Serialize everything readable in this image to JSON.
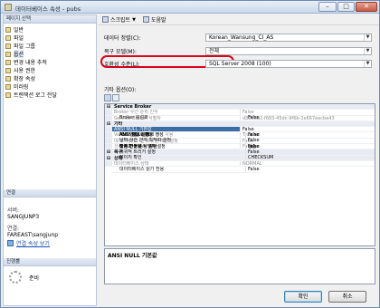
{
  "window": {
    "title": "데이터베이스 속성 - pubs"
  },
  "left": {
    "pages_header": "페이지 선택",
    "pages": [
      {
        "label": "일반",
        "selected": false
      },
      {
        "label": "파일",
        "selected": false
      },
      {
        "label": "파일 그룹",
        "selected": false
      },
      {
        "label": "옵션",
        "selected": true
      },
      {
        "label": "변경 내용 추적",
        "selected": false
      },
      {
        "label": "사용 권한",
        "selected": false
      },
      {
        "label": "확장 속성",
        "selected": false
      },
      {
        "label": "미러링",
        "selected": false
      },
      {
        "label": "트랜잭션 로그 전달",
        "selected": false
      }
    ],
    "connection_header": "연결",
    "server_label": "서버:",
    "server_value": "SANGJUNP3",
    "connection_label": "연결:",
    "connection_value": "FAREAST\\sangjunp",
    "connection_link": "연결 속성 보기",
    "progress_header": "진행률",
    "progress_status": "준비"
  },
  "toolbar": {
    "script_label": "스크립트",
    "help_label": "도움말"
  },
  "form": {
    "collation_label": "데이터 정렬(C):",
    "collation_value": "Korean_Wansung_CI_AS",
    "recovery_label": "복구 모델(M):",
    "recovery_value": "전체",
    "compat_label": "호환성 수준(L):",
    "compat_value": "SQL Server 2008 (100)",
    "other_options_label": "기타 옵션(O):"
  },
  "properties": [
    {
      "type": "cat",
      "name": "Service Broker",
      "value": ""
    },
    {
      "type": "ro",
      "name": "Broker 우선 순위 인식",
      "value": "False"
    },
    {
      "type": "row",
      "name": "Broker 활성화",
      "value": "False"
    },
    {
      "type": "ro",
      "name": "Service Broker 식별자",
      "value": "d3298b2-f683-45dc-9f6b-2e667eecbe43"
    },
    {
      "type": "cat",
      "name": "기타",
      "value": ""
    },
    {
      "type": "sel",
      "name": "ANSI NULL 기본값",
      "value": "False"
    },
    {
      "type": "row",
      "name": "ANSI NULL 설정",
      "value": "False"
    },
    {
      "type": "row",
      "name": "ANSI 경고 설정",
      "value": "False"
    },
    {
      "type": "row",
      "name": "ANSI 패딩 설정",
      "value": "False"
    },
    {
      "type": "row",
      "name": "Null 연결 시 Null 생성",
      "value": "False"
    },
    {
      "type": "ro",
      "name": "VarDecimal 저장소 형식 사용",
      "value": "True"
    },
    {
      "type": "row",
      "name": "날짜 상관 관계 최적화 설정",
      "value": "False"
    },
    {
      "type": "ro",
      "name": "데이터베이스 간 소유권 체인 설정",
      "value": "False"
    },
    {
      "type": "row",
      "name": "따옴표 붙은 식별자 설정",
      "value": "False"
    },
    {
      "type": "row",
      "name": "매개 변수화",
      "value": "단순"
    },
    {
      "type": "row",
      "name": "산술 연산 중단 설정",
      "value": "False"
    },
    {
      "type": "row",
      "name": "숫자 반올림 시 중단",
      "value": "False"
    },
    {
      "type": "ro",
      "name": "신뢰",
      "value": "False"
    },
    {
      "type": "row",
      "name": "재귀적 트리거 설정",
      "value": "False"
    },
    {
      "type": "cat",
      "name": "복구",
      "value": ""
    },
    {
      "type": "row",
      "name": "페이지 확인",
      "value": "CHECKSUM"
    },
    {
      "type": "cat",
      "name": "상태",
      "value": ""
    },
    {
      "type": "ro",
      "name": "데이터베이스 상태",
      "value": "NORMAL"
    },
    {
      "type": "row",
      "name": "데이터베이스 읽기 전용",
      "value": "False"
    }
  ],
  "description": "ANSI NULL 기본값",
  "buttons": {
    "ok": "확인",
    "cancel": "취소"
  }
}
